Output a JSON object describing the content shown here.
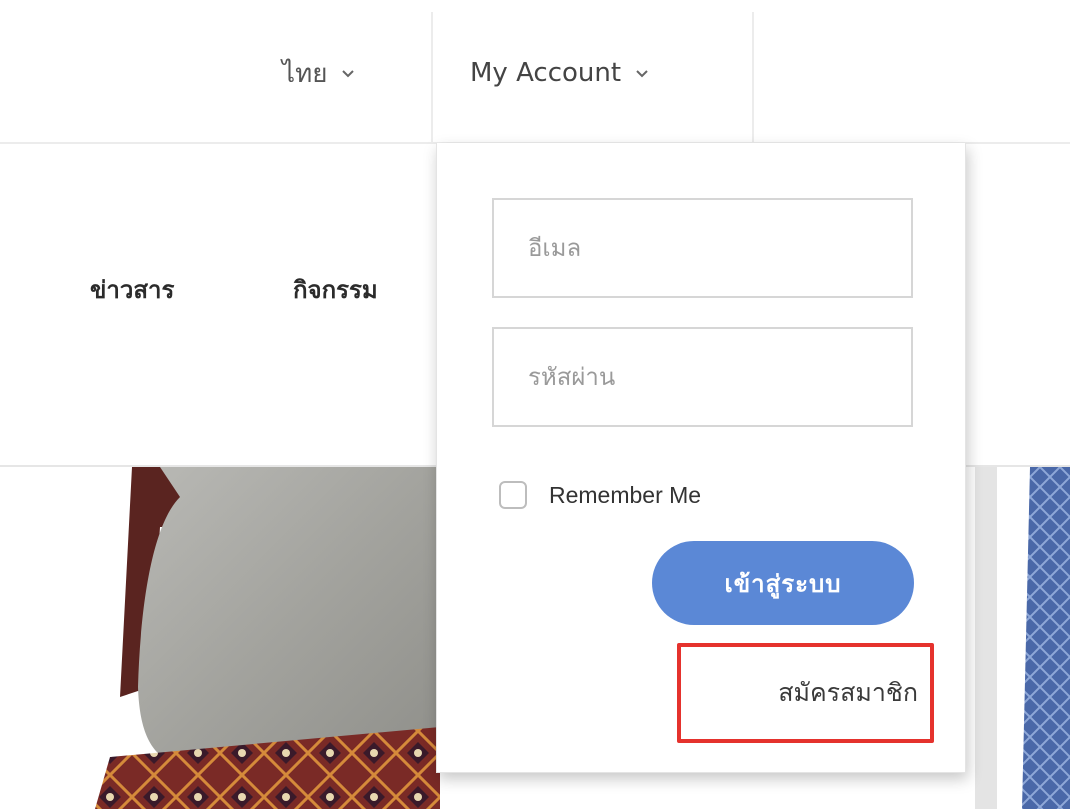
{
  "topbar": {
    "language_label": "ไทย",
    "account_label": "My Account"
  },
  "nav": {
    "items": [
      {
        "label": "ข่าวสาร"
      },
      {
        "label": "กิจกรรม"
      }
    ]
  },
  "login": {
    "email_placeholder": "อีเมล",
    "password_placeholder": "รหัสผ่าน",
    "remember_label": "Remember Me",
    "remember_checked": false,
    "submit_label": "เข้าสู่ระบบ",
    "register_label": "สมัครสมาชิก"
  },
  "colors": {
    "submit_button": "#5b88d6",
    "highlight_box": "#e5322d"
  },
  "icons": {
    "language_dropdown": "chevron-down-icon",
    "account_dropdown": "chevron-down-icon"
  }
}
